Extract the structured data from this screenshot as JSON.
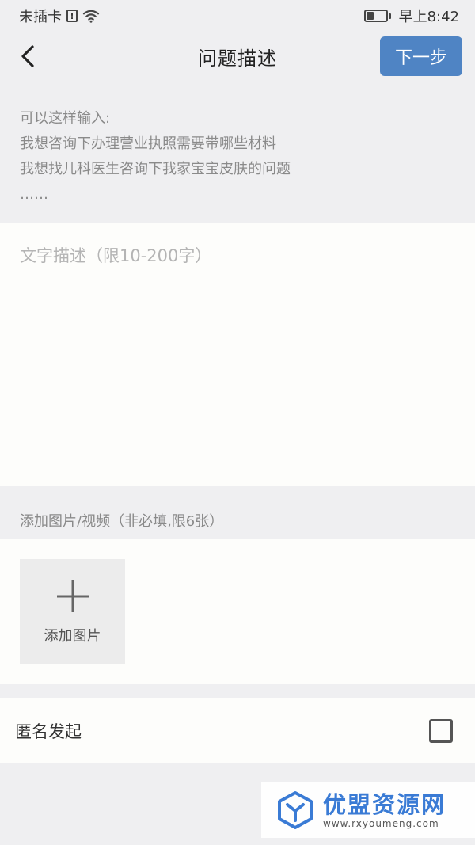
{
  "status_bar": {
    "carrier": "未插卡",
    "sim_glyph": "!",
    "time": "早上8:42",
    "battery_level": 0.4
  },
  "nav": {
    "title": "问题描述",
    "next_label": "下一步"
  },
  "hint": {
    "lines": [
      "可以这样输入:",
      "我想咨询下办理营业执照需要带哪些材料",
      "我想找儿科医生咨询下我家宝宝皮肤的问题",
      "……"
    ]
  },
  "description": {
    "value": "",
    "placeholder": "文字描述（限10-200字）"
  },
  "media": {
    "label": "添加图片/视频（非必填,限6张）",
    "add_image_label": "添加图片"
  },
  "anonymous": {
    "label": "匿名发起",
    "checked": false
  },
  "watermark": {
    "title": "优盟资源网",
    "url": "www.rxyoumeng.com"
  },
  "colors": {
    "accent": "#4f84c4",
    "background": "#efeff1",
    "panel": "#fdfdfb",
    "watermark": "#3a7bd5"
  }
}
